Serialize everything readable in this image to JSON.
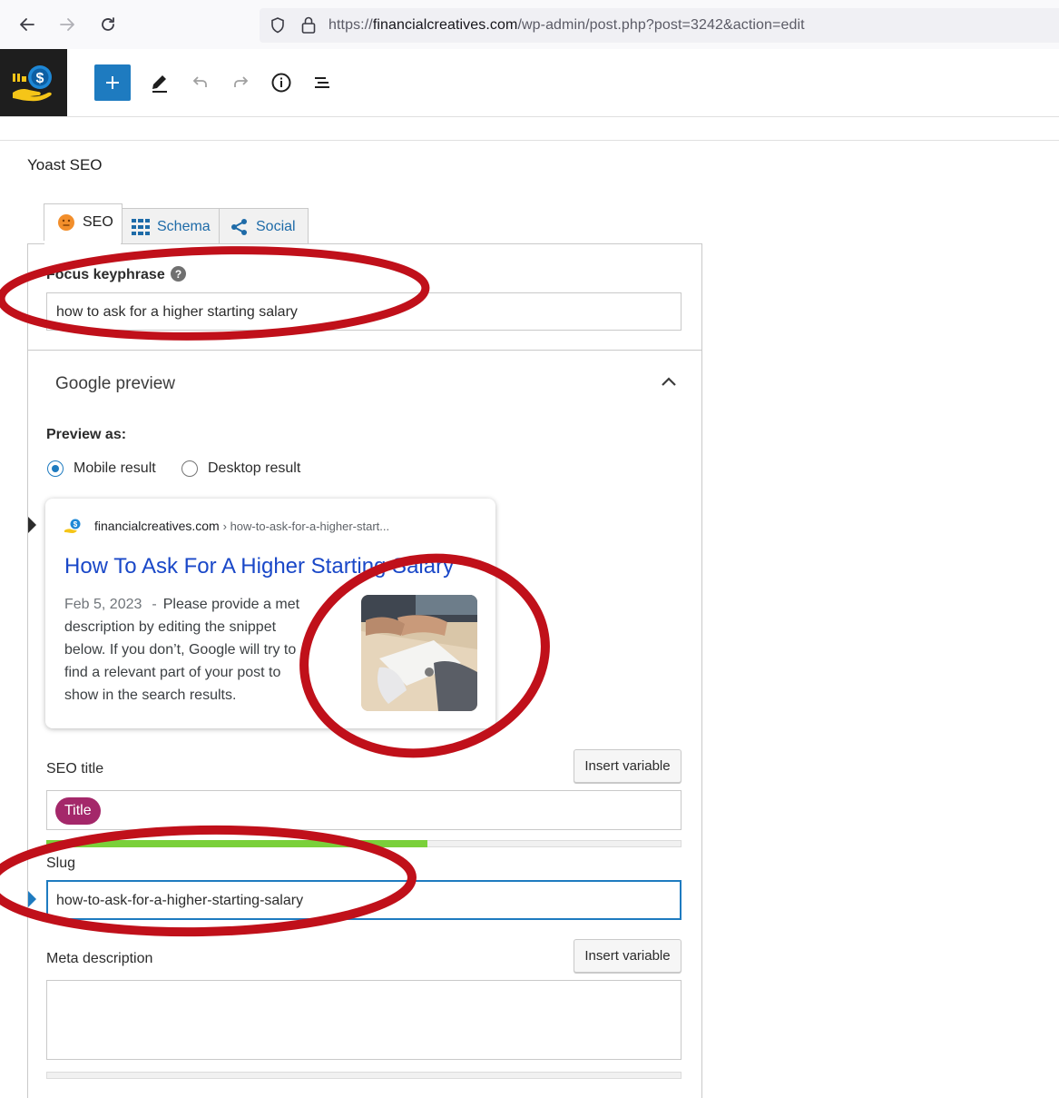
{
  "browser": {
    "url_prefix": "https://",
    "url_host": "financialcreatives.com",
    "url_path": "/wp-admin/post.php?post=3242&action=edit"
  },
  "yoast": {
    "heading": "Yoast SEO",
    "tabs": [
      {
        "label": "SEO",
        "icon": "sad-face-icon"
      },
      {
        "label": "Schema",
        "icon": "grid-icon"
      },
      {
        "label": "Social",
        "icon": "share-icon"
      }
    ],
    "focus_keyphrase": {
      "label": "Focus keyphrase",
      "value": "how to ask for a higher starting salary"
    },
    "google_preview": {
      "heading": "Google preview",
      "preview_as_label": "Preview as:",
      "options": [
        "Mobile result",
        "Desktop result"
      ],
      "selected": "Mobile result",
      "card": {
        "site": "financialcreatives.com",
        "breadcrumb": "› how-to-ask-for-a-higher-start...",
        "title": "How To Ask For A Higher Starting Salary",
        "date": "Feb 5, 2023",
        "separator": "-",
        "snippet_lines": [
          "Please provide a meta",
          "description by editing the snippet",
          "below. If you don’t, Google will try to",
          "find a relevant part of your post to",
          "show in the search results."
        ]
      }
    },
    "seo_title": {
      "label": "SEO title",
      "insert_label": "Insert variable",
      "pill": "Title",
      "progress": 0.6
    },
    "slug": {
      "label": "Slug",
      "value": "how-to-ask-for-a-higher-starting-salary"
    },
    "meta_description": {
      "label": "Meta description",
      "insert_label": "Insert variable",
      "value": ""
    }
  },
  "colors": {
    "accent_blue": "#1e7bc0",
    "pill_purple": "#a4286a",
    "progress_green": "#7ad03a",
    "annotation_red": "#c0101a",
    "preview_link": "#1a48c8"
  }
}
